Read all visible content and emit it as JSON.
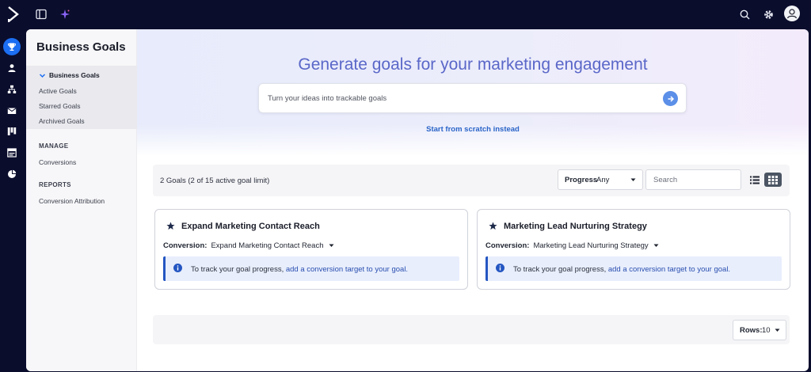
{
  "topbar": {
    "icons": [
      "app-logo-icon",
      "panel-toggle-icon",
      "sparkle-icon",
      "search-icon",
      "gear-icon",
      "user-avatar-icon"
    ]
  },
  "rail": {
    "items": [
      "trophy-icon",
      "person-icon",
      "org-chart-icon",
      "mail-icon",
      "kanban-icon",
      "layout-icon",
      "pie-chart-icon"
    ],
    "active": "trophy-icon"
  },
  "sidenav": {
    "title": "Business Goals",
    "group_label": "Business Goals",
    "group_items": [
      "Active Goals",
      "Starred Goals",
      "Archived Goals"
    ],
    "manage_heading": "MANAGE",
    "manage_items": [
      "Conversions"
    ],
    "reports_heading": "REPORTS",
    "reports_items": [
      "Conversion Attribution"
    ]
  },
  "hero": {
    "title": "Generate goals for your marketing engagement",
    "input_placeholder": "Turn your ideas into trackable goals",
    "scratch_link": "Start from scratch instead"
  },
  "toolbar": {
    "goal_count": "2 Goals (2 of 15 active goal limit)",
    "progress_label": "Progress",
    "progress_value": "Any",
    "search_placeholder": "Search",
    "active_view": "grid"
  },
  "goals": [
    {
      "title": "Expand Marketing Contact Reach",
      "conversion_label": "Conversion:",
      "conversion_value": "Expand Marketing Contact Reach",
      "info_text": "To track your goal progress, ",
      "info_link": "add a conversion target to your goal."
    },
    {
      "title": "Marketing Lead Nurturing Strategy",
      "conversion_label": "Conversion:",
      "conversion_value": "Marketing Lead Nurturing Strategy",
      "info_text": "To track your goal progress, ",
      "info_link": "add a conversion target to your goal."
    }
  ],
  "pagination": {
    "rows_label": "Rows:",
    "rows_value": "10"
  },
  "colors": {
    "rail_bg": "#0a0d2c",
    "accent": "#1c6ef2",
    "hero_title": "#5a67c8",
    "link": "#2a4fb0",
    "info_bg": "#e8eefc",
    "info_border": "#2456c2"
  }
}
